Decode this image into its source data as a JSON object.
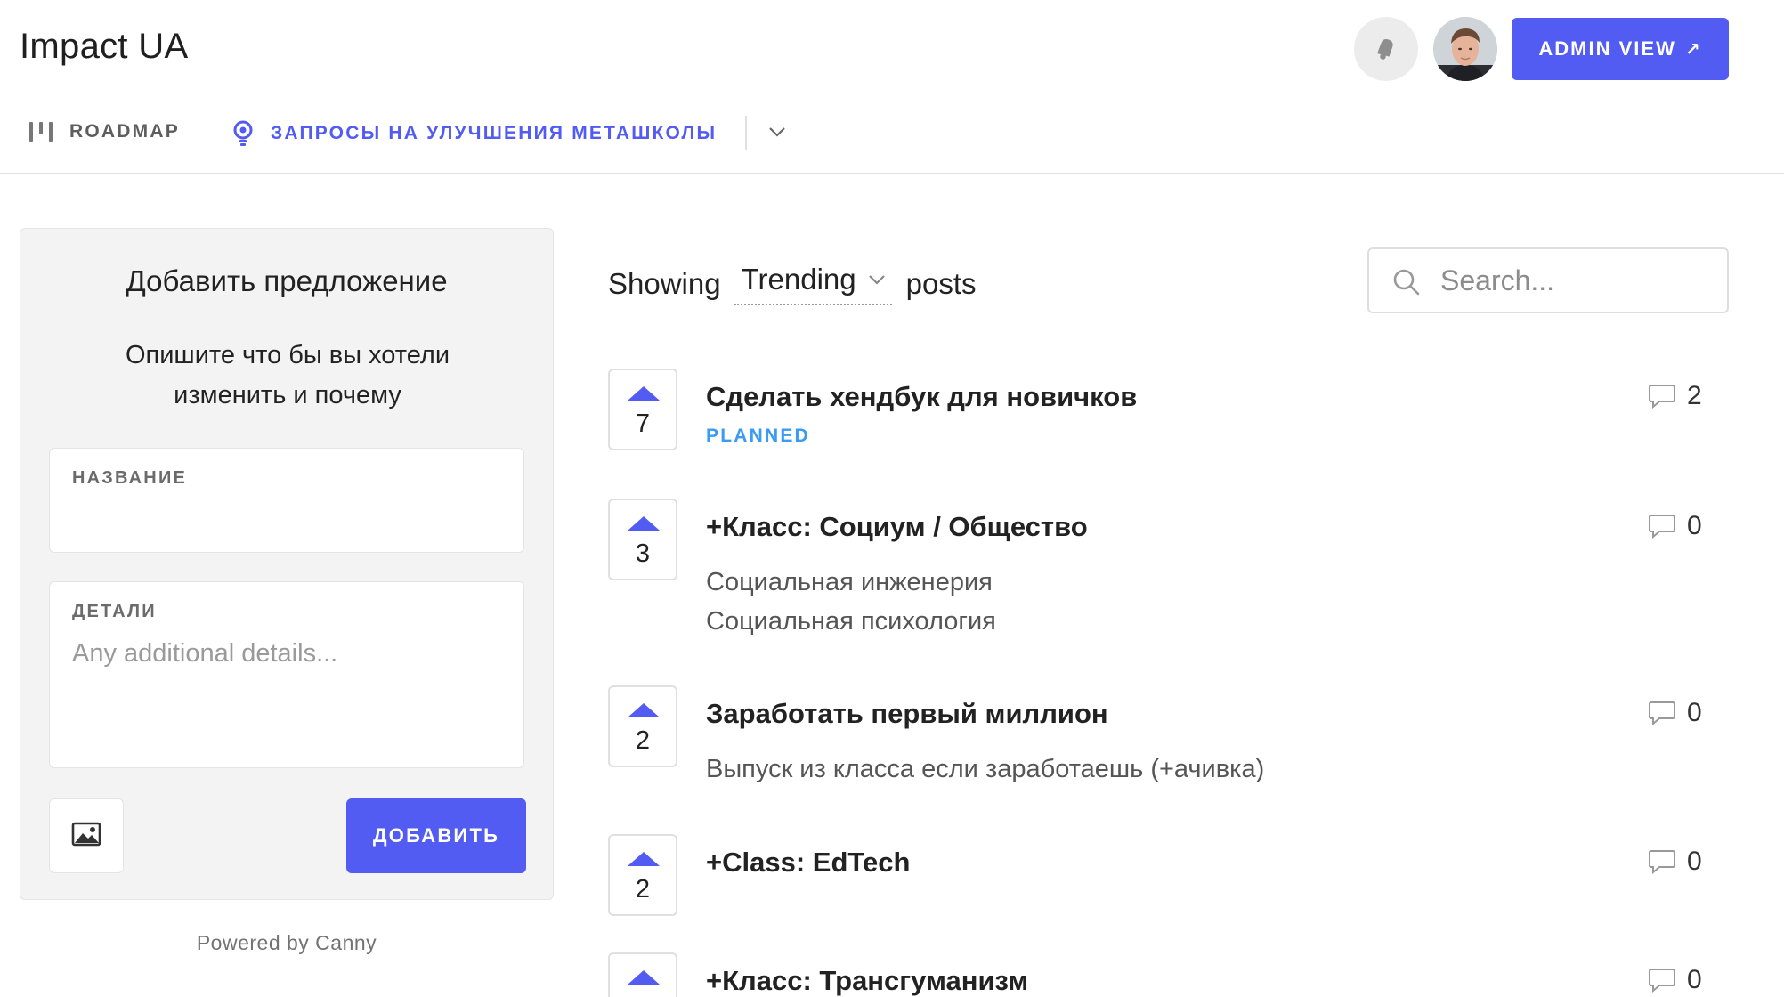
{
  "header": {
    "title": "Impact UA",
    "admin_button": "ADMIN VIEW",
    "admin_arrow": "↗"
  },
  "nav": {
    "roadmap": "ROADMAP",
    "board": "ЗАПРОСЫ НА УЛУЧШЕНИЯ МЕТАШКОЛЫ"
  },
  "form": {
    "title": "Добавить предложение",
    "description": "Опишите что бы вы хотели изменить и почему",
    "title_label": "НАЗВАНИЕ",
    "details_label": "ДЕТАЛИ",
    "details_placeholder": "Any additional details...",
    "submit": "ДОБАВИТЬ"
  },
  "footer": {
    "powered": "Powered by Canny"
  },
  "list": {
    "showing": "Showing",
    "sort": "Trending",
    "posts": "posts",
    "search_placeholder": "Search..."
  },
  "posts": [
    {
      "votes": "7",
      "title": "Сделать хендбук для новичков",
      "status": "PLANNED",
      "lines": [],
      "comments": "2"
    },
    {
      "votes": "3",
      "title": "+Класс: Социум / Общество",
      "status": "",
      "lines": [
        "Социальная инженерия",
        "Социальная психология"
      ],
      "comments": "0"
    },
    {
      "votes": "2",
      "title": "Заработать первый миллион",
      "status": "",
      "lines": [
        "Выпуск из класса если заработаешь (+ачивка)"
      ],
      "comments": "0"
    },
    {
      "votes": "2",
      "title": "+Class: EdTech",
      "status": "",
      "lines": [],
      "comments": "0"
    },
    {
      "votes": "",
      "title": "+Класс: Трансгуманизм",
      "status": "",
      "lines": [],
      "comments": "0"
    }
  ],
  "colors": {
    "accent": "#525bf2",
    "status_planned": "#3a9bf2"
  },
  "icons": [
    "bell-icon",
    "roadmap-icon",
    "lightbulb-icon",
    "chevron-down-icon",
    "image-icon",
    "search-icon",
    "comment-icon",
    "upvote-arrow-icon"
  ]
}
